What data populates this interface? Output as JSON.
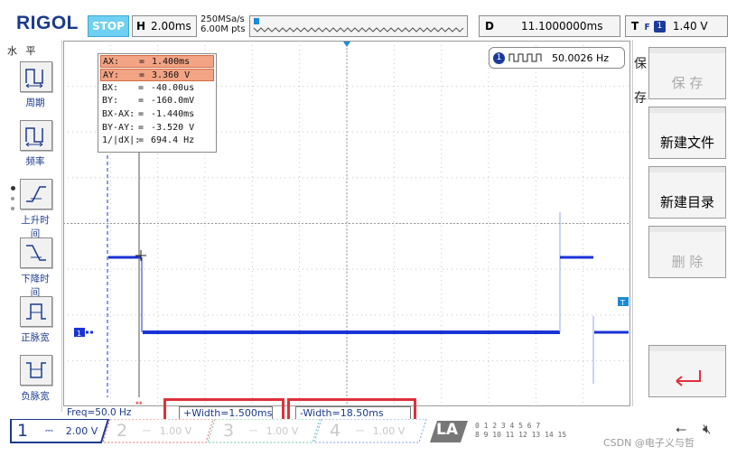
{
  "header": {
    "brand": "RIGOL",
    "run_state": "STOP",
    "timebase_key": "H",
    "timebase_value": "2.00ms",
    "sample_rate": "250MSa/s",
    "memory_depth": "6.00M pts",
    "delay_key": "D",
    "delay_value": "11.1000000ms",
    "trigger_key": "T",
    "trigger_channel": "1",
    "trigger_level": "1.40 V"
  },
  "left_menu": {
    "title": "水 平",
    "items": [
      {
        "label": "周期",
        "icon": "period-icon"
      },
      {
        "label": "频率",
        "icon": "frequency-icon"
      },
      {
        "label": "上升时间",
        "icon": "rise-time-icon"
      },
      {
        "label": "下降时间",
        "icon": "fall-time-icon"
      },
      {
        "label": "正脉宽",
        "icon": "positive-width-icon"
      },
      {
        "label": "负脉宽",
        "icon": "negative-width-icon"
      }
    ]
  },
  "measurements": {
    "rows": [
      {
        "name": "AX:",
        "value": "1.400ms",
        "highlight": true
      },
      {
        "name": "AY:",
        "value": "3.360 V",
        "highlight": true
      },
      {
        "name": "BX:",
        "value": "-40.00us",
        "highlight": false
      },
      {
        "name": "BY:",
        "value": "-160.0mV",
        "highlight": false
      },
      {
        "name": "BX-AX:",
        "value": "-1.440ms",
        "highlight": false
      },
      {
        "name": "BY-AY:",
        "value": "-3.520 V",
        "highlight": false
      },
      {
        "name": "1/|dX|:",
        "value": "694.4 Hz",
        "highlight": false
      }
    ],
    "equals": "="
  },
  "freq_counter": {
    "channel": "1",
    "value": "50.0026 Hz"
  },
  "bottom_readouts": {
    "freq": "Freq=50.0 Hz",
    "pos_width": "+Width=1.500ms",
    "neg_width": "-Width=18.50ms"
  },
  "channels": [
    {
      "num": "1",
      "scale": "2.00 V",
      "active": true
    },
    {
      "num": "2",
      "scale": "1.00 V",
      "active": false
    },
    {
      "num": "3",
      "scale": "1.00 V",
      "active": false
    },
    {
      "num": "4",
      "scale": "1.00 V",
      "active": false
    }
  ],
  "la": {
    "label": "LA",
    "bits_top": "0 1 2 3   4 5 6 7",
    "bits_bottom": "8 9 10 11  12 13 14 15"
  },
  "right_menu": {
    "title_chars": [
      "保",
      "存"
    ],
    "buttons": [
      {
        "label": "保 存",
        "enabled": false
      },
      {
        "label": "新建文件",
        "enabled": true
      },
      {
        "label": "新建目录",
        "enabled": true
      },
      {
        "label": "删 除",
        "enabled": false
      },
      {
        "label": "",
        "enabled": true
      }
    ]
  },
  "markers": {
    "channel_marker": "1",
    "trigger_marker": "T"
  },
  "watermark": "CSDN @电子义与哲",
  "colors": {
    "trace": "#1a33d6",
    "accent": "#1b3a8c",
    "stop": "#6fd0f2",
    "highlight_box": "#e0303a"
  }
}
